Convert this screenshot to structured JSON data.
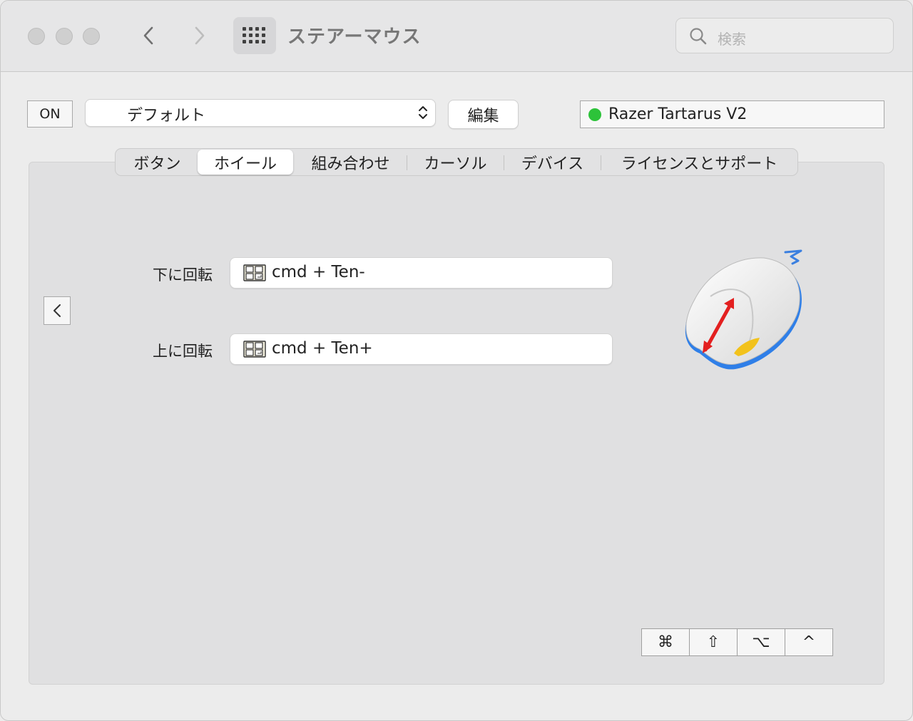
{
  "window": {
    "title": "ステアーマウス",
    "search_placeholder": "検索"
  },
  "toolbar": {
    "on_label": "ON",
    "preset_value": "デフォルト",
    "edit_label": "編集",
    "device_name": "Razer Tartarus V2",
    "device_status_color": "#2dc33a"
  },
  "tabs": [
    {
      "label": "ボタン",
      "active": false
    },
    {
      "label": "ホイール",
      "active": true
    },
    {
      "label": "組み合わせ",
      "active": false
    },
    {
      "label": "カーソル",
      "active": false
    },
    {
      "label": "デバイス",
      "active": false
    },
    {
      "label": "ライセンスとサポート",
      "active": false
    }
  ],
  "wheel": {
    "rows": [
      {
        "label": "下に回転",
        "value": "cmd + Ten-"
      },
      {
        "label": "上に回転",
        "value": "cmd + Ten+"
      }
    ]
  },
  "modifiers": [
    {
      "symbol": "⌘",
      "icon": "command-key-icon"
    },
    {
      "symbol": "⇧",
      "icon": "shift-key-icon"
    },
    {
      "symbol": "⌥",
      "icon": "option-key-icon"
    },
    {
      "symbol": "^",
      "icon": "control-key-icon"
    }
  ]
}
